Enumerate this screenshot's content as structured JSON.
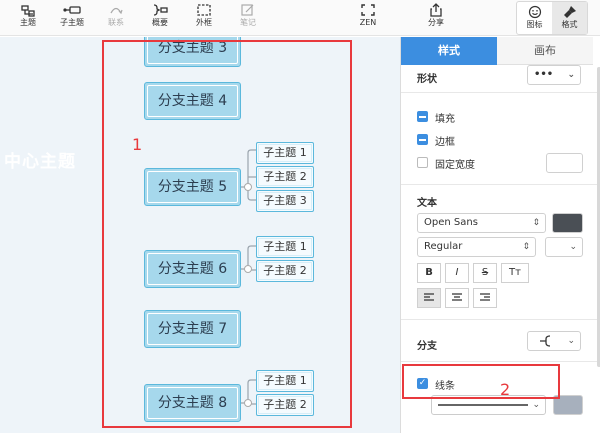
{
  "toolbar": {
    "buttons": [
      {
        "label": "主题",
        "icon": "topic-icon",
        "enabled": true
      },
      {
        "label": "子主题",
        "icon": "subtopic-icon",
        "enabled": true
      },
      {
        "label": "联系",
        "icon": "relationship-icon",
        "enabled": false
      },
      {
        "label": "概要",
        "icon": "summary-icon",
        "enabled": true
      },
      {
        "label": "外框",
        "icon": "boundary-icon",
        "enabled": true
      },
      {
        "label": "笔记",
        "icon": "note-icon",
        "enabled": false
      }
    ],
    "zen_label": "ZEN",
    "share_label": "分享",
    "segment": [
      {
        "label": "图标",
        "icon": "emoji-icon",
        "active": false
      },
      {
        "label": "格式",
        "icon": "format-brush-icon",
        "active": true
      }
    ]
  },
  "canvas": {
    "ghost_title": "中心主题",
    "branches": [
      {
        "label": "分支主题 3",
        "subtopics": []
      },
      {
        "label": "分支主题 4",
        "subtopics": []
      },
      {
        "label": "分支主题 5",
        "subtopics": [
          "子主题 1",
          "子主题 2",
          "子主题 3"
        ]
      },
      {
        "label": "分支主题 6",
        "subtopics": [
          "子主题 1",
          "子主题 2"
        ]
      },
      {
        "label": "分支主题 7",
        "subtopics": []
      },
      {
        "label": "分支主题 8",
        "subtopics": [
          "子主题 1",
          "子主题 2"
        ]
      }
    ],
    "annotations": [
      "1",
      "2"
    ]
  },
  "panel": {
    "tabs": [
      "样式",
      "画布"
    ],
    "shape_section": {
      "title": "形状",
      "shape_value": "•••"
    },
    "checks": [
      {
        "label": "填充",
        "state": "minus"
      },
      {
        "label": "边框",
        "state": "minus"
      },
      {
        "label": "固定宽度",
        "state": "unchecked"
      }
    ],
    "text_section": {
      "title": "文本",
      "font_family": "Open Sans",
      "font_weight": "Regular",
      "text_color": "#4a4f55",
      "format_buttons": [
        "B",
        "I",
        "S",
        "Tт"
      ],
      "align_buttons": [
        "align-left",
        "align-center",
        "align-right"
      ]
    },
    "branch_section": {
      "title": "分支",
      "line_label": "线条",
      "line_checked": true
    },
    "colors": {
      "accent": "#3c8ee0",
      "annotation": "#e8393d",
      "branch_fill": "#a6d8ec",
      "line_swatch": "#a7b0bd"
    }
  }
}
